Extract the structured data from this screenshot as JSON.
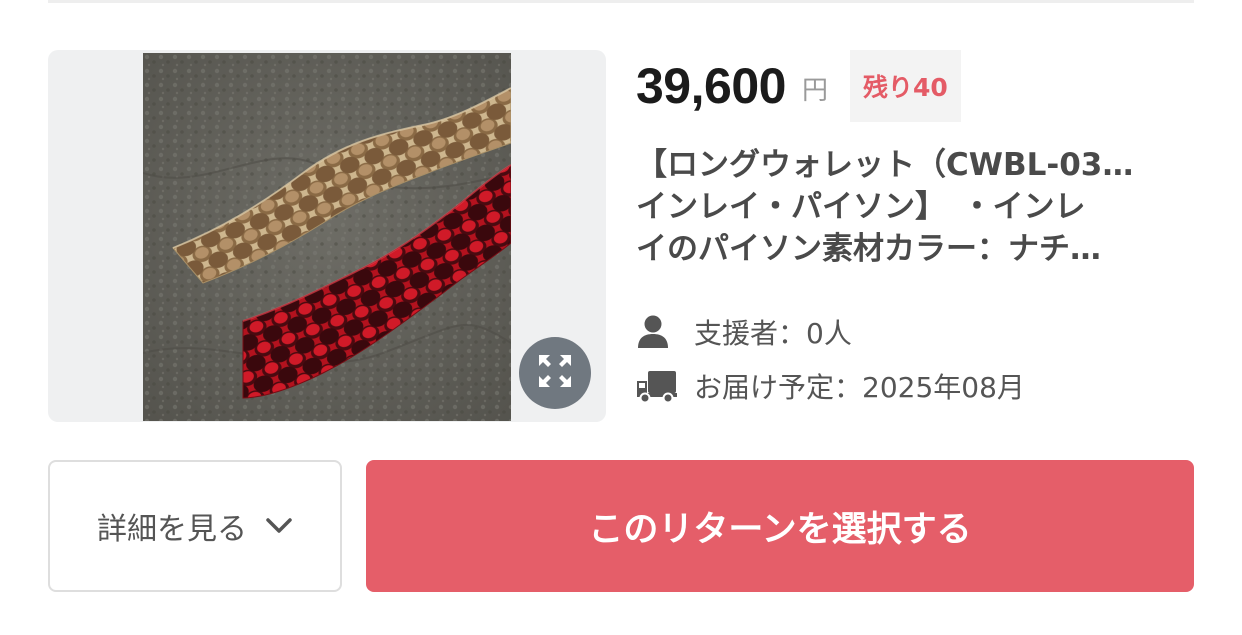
{
  "reward": {
    "price": "39,600",
    "price_unit": "円",
    "remaining_label": "残り40",
    "title_lines": [
      "【ロングウォレット（CWBL-03…",
      "インレイ・パイソン】　・インレ",
      "イのパイソン素材カラー：ナチ…"
    ],
    "supporters_text": "支援者：0人",
    "delivery_text": "お届け予定：2025年08月",
    "image_alt": "python leather strips on grey leather"
  },
  "actions": {
    "details_label": "詳細を見る",
    "select_label": "このリターンを選択する"
  },
  "icons": {
    "expand": "expand-icon",
    "person": "person-icon",
    "truck": "truck-icon",
    "chevron": "chevron-down-icon"
  },
  "colors": {
    "accent": "#e55e69",
    "badge_text": "#e45b66",
    "badge_bg": "#f3f3f3",
    "price": "#1b1b1b"
  }
}
